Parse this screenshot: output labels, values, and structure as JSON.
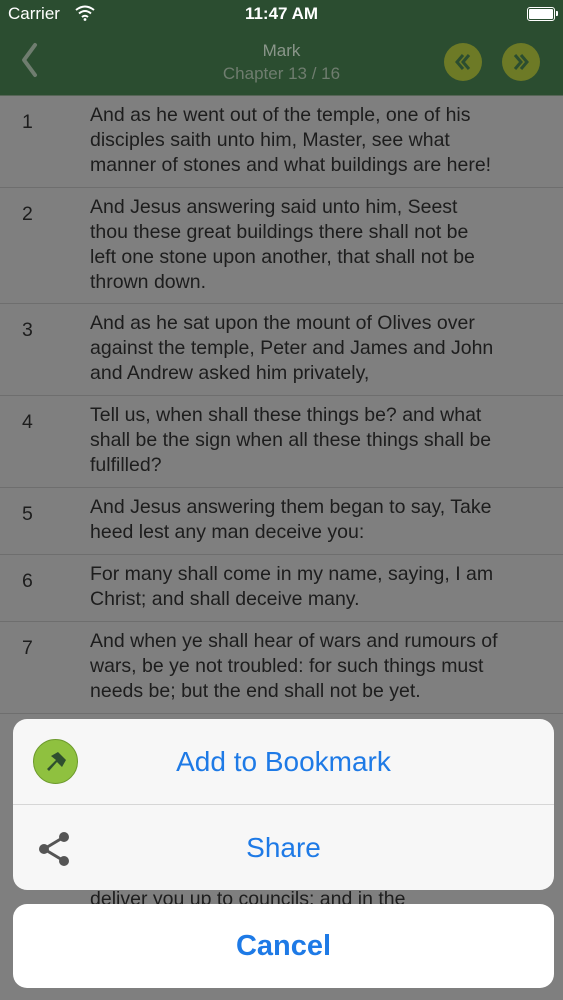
{
  "status_bar": {
    "carrier": "Carrier",
    "time": "11:47 AM"
  },
  "header": {
    "title": "Mark",
    "subtitle": "Chapter 13 / 16"
  },
  "verses": [
    {
      "number": "1",
      "lines": [
        "And as he went out of the temple, one of his",
        "disciples saith unto him, Master, see what",
        "manner of stones and what buildings are here!"
      ]
    },
    {
      "number": "2",
      "lines": [
        "And Jesus answering said unto him, Seest",
        "thou these great buildings there shall not be",
        "left one stone upon another, that shall not be",
        "thrown down."
      ]
    },
    {
      "number": "3",
      "lines": [
        "And as he sat upon the mount of Olives over",
        "against the temple, Peter and James and John",
        "and Andrew asked him privately,"
      ]
    },
    {
      "number": "4",
      "lines": [
        "Tell us, when shall these things be? and what",
        "shall be the sign when all these things shall be",
        "fulfilled?"
      ]
    },
    {
      "number": "5",
      "lines": [
        "And Jesus answering them began to say, Take",
        "heed lest any man deceive you:"
      ]
    },
    {
      "number": "6",
      "lines": [
        "For many shall come in my name, saying, I am",
        "Christ; and shall deceive many."
      ]
    },
    {
      "number": "7",
      "lines": [
        "And when ye shall hear of wars and rumours of",
        "wars, be ye not troubled: for such things must",
        "needs be; but the end shall not be yet."
      ]
    }
  ],
  "partial_text": "deliver you up to councils: and in the",
  "action_sheet": {
    "bookmark_label": "Add to Bookmark",
    "share_label": "Share",
    "cancel_label": "Cancel"
  },
  "colors": {
    "accent": "#1e7ae6",
    "nav_background": "#2b4d30",
    "bookmark_green": "#8fc13f"
  }
}
